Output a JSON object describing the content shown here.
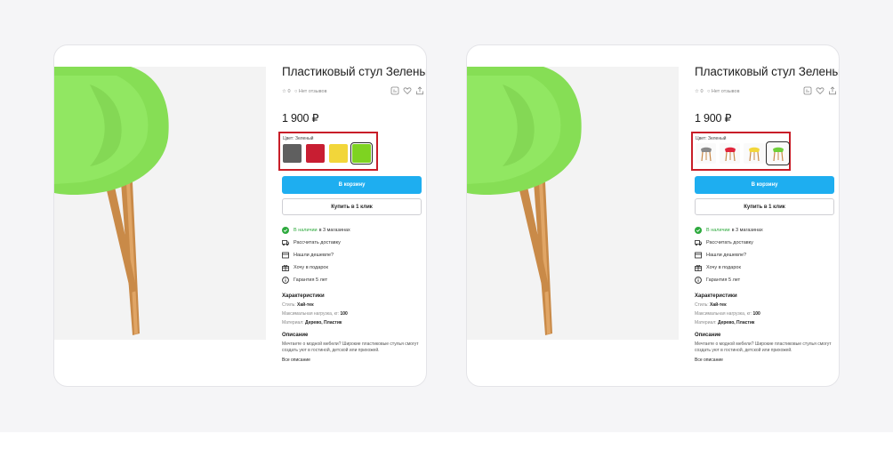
{
  "product": {
    "title": "Пластиковый стул Зеленый",
    "rating": "0",
    "reviews": "Нет отзывов",
    "price": "1 900 ₽",
    "color_label": "Цвет: Зеленый",
    "add_to_cart": "В корзину",
    "buy_one_click": "Купить в 1 клик",
    "availability_green": "В наличии",
    "availability_rest": "в 3 магазинах",
    "options": {
      "delivery": "Рассчитать доставку",
      "cheaper": "Нашли дешевле?",
      "gift": "Хочу в подарок",
      "warranty": "Гарантия 5 лет"
    },
    "specs_title": "Характеристики",
    "specs": [
      {
        "label": "Стиль:",
        "value": "Хай-тек"
      },
      {
        "label": "Максимальная нагрузка, кг:",
        "value": "100"
      },
      {
        "label": "Материал:",
        "value": "Дерево, Пластик"
      }
    ],
    "description_title": "Описание",
    "description_text": "Мечтаете о модной мебели? Широкие пластиковые стулья смогут создать уют в гостиной, детской или прихожей.",
    "all_description": "Все описание"
  },
  "swatches": [
    "#5f5f5f",
    "#c81e32",
    "#f2d63a",
    "#7ed321"
  ],
  "colors": {
    "accent": "#1eaef0",
    "highlight_border": "#c81e28",
    "in_stock": "#2eaa3e",
    "chair_green": "#88e05a"
  },
  "icons": [
    "star-icon",
    "comment-icon",
    "compare-icon",
    "heart-icon",
    "share-icon",
    "check-circle-icon",
    "truck-icon",
    "tag-icon",
    "gift-icon",
    "info-icon"
  ]
}
